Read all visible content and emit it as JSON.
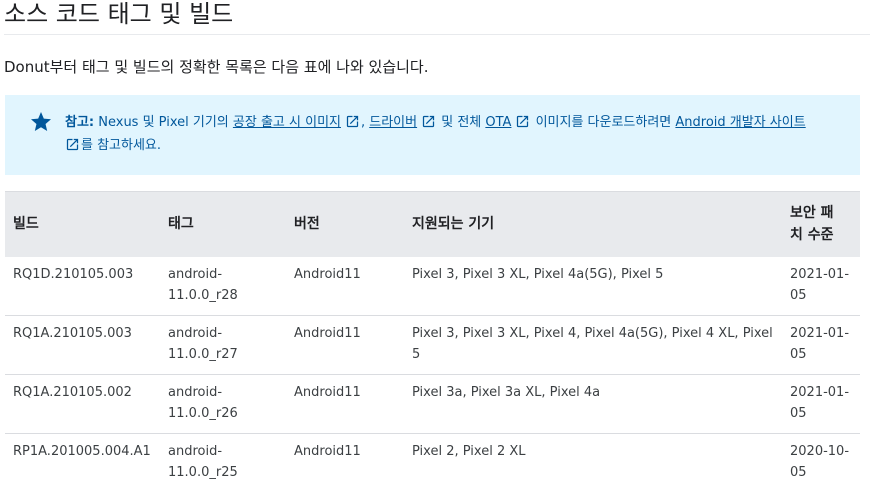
{
  "page": {
    "title": "소스 코드 태그 및 빌드",
    "intro": "Donut부터 태그 및 빌드의 정확한 목록은 다음 표에 나와 있습니다."
  },
  "note": {
    "icon": "star-icon",
    "label": "참고:",
    "text_1": " Nexus 및 Pixel 기기의 ",
    "link_factory": "공장 출고 시 이미지",
    "sep_1": ", ",
    "link_drivers": "드라이버",
    "text_2": " 및 전체 ",
    "link_ota": "OTA",
    "text_3": " 이미지를 다운로드하려면 ",
    "link_dev_site": "Android 개발자 사이트",
    "text_4": "를 참고하세요."
  },
  "table": {
    "headers": {
      "build": "빌드",
      "tag": "태그",
      "version": "버전",
      "devices": "지원되는 기기",
      "security_line1": "보안 패",
      "security_line2": "치 수준"
    },
    "rows": [
      {
        "build": "RQ1D.210105.003",
        "tag_1": "android-",
        "tag_2": "11.0.0_r28",
        "version": "Android11",
        "devices": "Pixel 3, Pixel 3 XL, Pixel 4a(5G), Pixel 5",
        "patch_1": "2021-01-",
        "patch_2": "05"
      },
      {
        "build": "RQ1A.210105.003",
        "tag_1": "android-",
        "tag_2": "11.0.0_r27",
        "version": "Android11",
        "devices": "Pixel 3, Pixel 3 XL, Pixel 4, Pixel 4a(5G), Pixel 4 XL, Pixel 5",
        "patch_1": "2021-01-",
        "patch_2": "05"
      },
      {
        "build": "RQ1A.210105.002",
        "tag_1": "android-",
        "tag_2": "11.0.0_r26",
        "version": "Android11",
        "devices": "Pixel 3a, Pixel 3a XL, Pixel 4a",
        "patch_1": "2021-01-",
        "patch_2": "05"
      },
      {
        "build": "RP1A.201005.004.A1",
        "tag_1": "android-",
        "tag_2": "11.0.0_r25",
        "version": "Android11",
        "devices": "Pixel 2, Pixel 2 XL",
        "patch_1": "2020-10-",
        "patch_2": "05"
      }
    ]
  }
}
